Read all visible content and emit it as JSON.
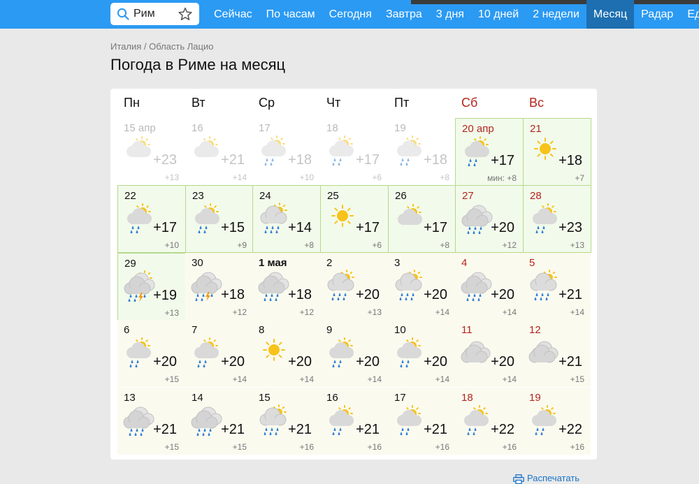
{
  "search": {
    "value": "Рим"
  },
  "nav": [
    "Сейчас",
    "По часам",
    "Сегодня",
    "Завтра",
    "3 дня",
    "10 дней",
    "2 недели",
    "Месяц",
    "Радар",
    "Ед"
  ],
  "nav_active": "Месяц",
  "breadcrumb": "Италия / Область Лацио",
  "page_title": "Погода в Риме на месяц",
  "weekdays": [
    "Пн",
    "Вт",
    "Ср",
    "Чт",
    "Пт",
    "Сб",
    "Вс"
  ],
  "weeks": [
    [
      {
        "date": "15 апр",
        "icon": "partly-cloudy",
        "high": "+23",
        "low": "+13",
        "state": "past"
      },
      {
        "date": "16",
        "icon": "partly-cloudy",
        "high": "+21",
        "low": "+14",
        "state": "past"
      },
      {
        "date": "17",
        "icon": "partly-cloudy-rain",
        "high": "+18",
        "low": "+10",
        "state": "past"
      },
      {
        "date": "18",
        "icon": "partly-cloudy-rain",
        "high": "+17",
        "low": "+6",
        "state": "past"
      },
      {
        "date": "19",
        "icon": "partly-cloudy-rain",
        "high": "+18",
        "low": "+8",
        "state": "past"
      },
      {
        "date": "20 апр",
        "icon": "partly-cloudy-rain",
        "high": "+17",
        "low": "мин: +8",
        "state": "current",
        "weekend": true
      },
      {
        "date": "21",
        "icon": "sun",
        "high": "+18",
        "low": "+7",
        "state": "current",
        "weekend": true
      }
    ],
    [
      {
        "date": "22",
        "icon": "partly-cloudy-rain",
        "high": "+17",
        "low": "+10",
        "state": "current"
      },
      {
        "date": "23",
        "icon": "partly-cloudy-rain",
        "high": "+15",
        "low": "+9",
        "state": "current"
      },
      {
        "date": "24",
        "icon": "cloudy-sun-rain",
        "high": "+14",
        "low": "+8",
        "state": "current"
      },
      {
        "date": "25",
        "icon": "sun",
        "high": "+17",
        "low": "+6",
        "state": "current"
      },
      {
        "date": "26",
        "icon": "partly-cloudy",
        "high": "+17",
        "low": "+8",
        "state": "current"
      },
      {
        "date": "27",
        "icon": "cloudy-rain",
        "high": "+20",
        "low": "+12",
        "state": "current",
        "weekend": true
      },
      {
        "date": "28",
        "icon": "partly-cloudy-rain",
        "high": "+23",
        "low": "+13",
        "state": "current",
        "weekend": true
      }
    ],
    [
      {
        "date": "29",
        "icon": "thunder",
        "high": "+19",
        "low": "+13",
        "state": "current"
      },
      {
        "date": "30",
        "icon": "cloud-thunder",
        "high": "+18",
        "low": "+12",
        "state": "future"
      },
      {
        "date": "1 мая",
        "icon": "cloudy-rain",
        "high": "+18",
        "low": "+12",
        "state": "future",
        "bold": true
      },
      {
        "date": "2",
        "icon": "cloudy-sun-rain",
        "high": "+20",
        "low": "+13",
        "state": "future"
      },
      {
        "date": "3",
        "icon": "cloudy-sun-rain",
        "high": "+20",
        "low": "+14",
        "state": "future"
      },
      {
        "date": "4",
        "icon": "cloudy-rain",
        "high": "+20",
        "low": "+14",
        "state": "future",
        "weekend": true
      },
      {
        "date": "5",
        "icon": "cloudy-sun-rain",
        "high": "+21",
        "low": "+14",
        "state": "future",
        "weekend": true
      }
    ],
    [
      {
        "date": "6",
        "icon": "partly-cloudy-rain",
        "high": "+20",
        "low": "+15",
        "state": "future"
      },
      {
        "date": "7",
        "icon": "partly-cloudy-rain",
        "high": "+20",
        "low": "+14",
        "state": "future"
      },
      {
        "date": "8",
        "icon": "sun",
        "high": "+20",
        "low": "+14",
        "state": "future"
      },
      {
        "date": "9",
        "icon": "partly-cloudy-rain",
        "high": "+20",
        "low": "+14",
        "state": "future"
      },
      {
        "date": "10",
        "icon": "partly-cloudy-rain",
        "high": "+20",
        "low": "+14",
        "state": "future"
      },
      {
        "date": "11",
        "icon": "cloudy",
        "high": "+20",
        "low": "+14",
        "state": "future",
        "weekend": true
      },
      {
        "date": "12",
        "icon": "cloudy",
        "high": "+21",
        "low": "+15",
        "state": "future",
        "weekend": true
      }
    ],
    [
      {
        "date": "13",
        "icon": "cloudy-rain",
        "high": "+21",
        "low": "+15",
        "state": "future"
      },
      {
        "date": "14",
        "icon": "cloudy-rain",
        "high": "+21",
        "low": "+15",
        "state": "future"
      },
      {
        "date": "15",
        "icon": "cloudy-sun-rain",
        "high": "+21",
        "low": "+16",
        "state": "future"
      },
      {
        "date": "16",
        "icon": "partly-cloudy-rain",
        "high": "+21",
        "low": "+16",
        "state": "future"
      },
      {
        "date": "17",
        "icon": "partly-cloudy-rain",
        "high": "+21",
        "low": "+16",
        "state": "future"
      },
      {
        "date": "18",
        "icon": "partly-cloudy-rain",
        "high": "+22",
        "low": "+16",
        "state": "future",
        "weekend": true
      },
      {
        "date": "19",
        "icon": "partly-cloudy-rain",
        "high": "+22",
        "low": "+16",
        "state": "future",
        "weekend": true
      }
    ]
  ],
  "print_label": "Распечатать",
  "colors": {
    "nav_bg": "#2b9af3",
    "nav_active_bg": "#1d6fb1",
    "weekend_text": "#b3261e",
    "sun": "#f7c31a",
    "rain": "#2f7fd5",
    "lightning": "#f09a1a"
  }
}
